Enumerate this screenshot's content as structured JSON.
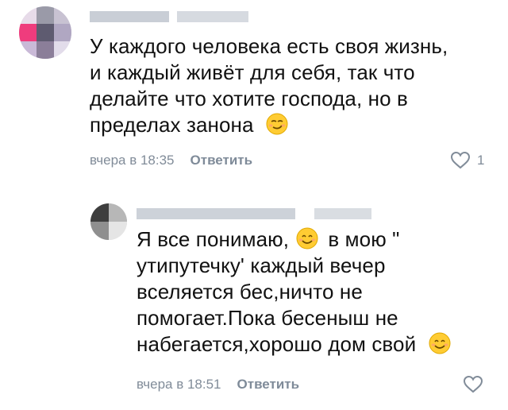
{
  "comments": [
    {
      "text_lines": [
        "У каждого человека есть своя жизнь,",
        "и каждый живёт для себя, так что",
        "делайте что хотите господа, но в",
        "пределах занона"
      ],
      "emoji": "smirk-emoji",
      "time": "вчера в 18:35",
      "reply_label": "Ответить",
      "likes": "1"
    },
    {
      "text_lines": [
        "Я все понимаю,",
        "в мою \"",
        "утипутечку' каждый вечер",
        "вселяется бес,ничто не",
        "помогает.Пока бесеныш не",
        "набегается,хорошо дом свой"
      ],
      "emoji": "smiling-face-emoji",
      "time": "вчера в 18:51",
      "reply_label": "Ответить",
      "likes": ""
    }
  ],
  "icons": {
    "like": "heart-outline-icon"
  },
  "colors": {
    "meta": "#818c99",
    "text": "#111111",
    "emoji_face": "#ffcc33"
  }
}
